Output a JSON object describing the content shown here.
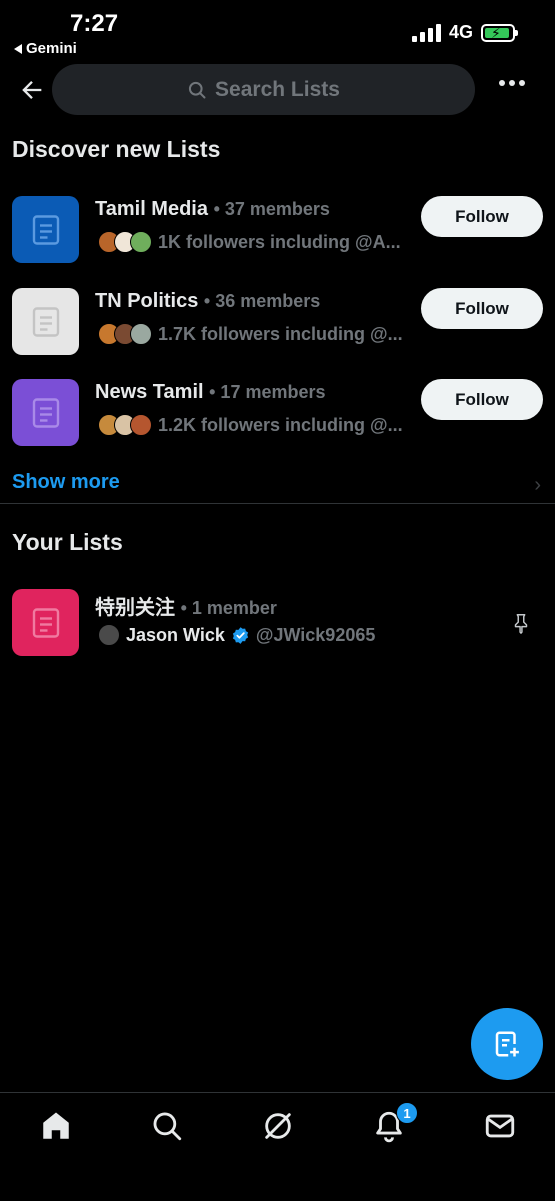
{
  "status_bar": {
    "time": "7:27",
    "back_app": "Gemini",
    "network": "4G"
  },
  "header": {
    "search_placeholder": "Search Lists"
  },
  "discover": {
    "title": "Discover new Lists",
    "items": [
      {
        "name": "Tamil Media",
        "members": "• 37 members",
        "followers": "1K followers including @A...",
        "follow_label": "Follow",
        "icon_color": "#0b5bb5",
        "icon_fg": "#5b9ae0"
      },
      {
        "name": "TN Politics",
        "members": "• 36 members",
        "followers": "1.7K followers including @...",
        "follow_label": "Follow",
        "icon_color": "#e6e6e6",
        "icon_fg": "#c4c4c4"
      },
      {
        "name": "News Tamil",
        "members": "• 17 members",
        "followers": "1.2K followers including @...",
        "follow_label": "Follow",
        "icon_color": "#7b4fd6",
        "icon_fg": "#a98ae8"
      }
    ],
    "show_more": "Show more"
  },
  "your_lists": {
    "title": "Your Lists",
    "items": [
      {
        "name": "特别关注",
        "members": "• 1 member",
        "owner_name": "Jason Wick",
        "owner_handle": "@JWick92065",
        "icon_color": "#e0245e",
        "icon_fg": "#f07aa0"
      }
    ]
  },
  "tabbar": {
    "tabs": [
      "home-icon",
      "search-icon",
      "grok-icon",
      "notifications-icon",
      "messages-icon"
    ],
    "notification_badge": "1"
  },
  "colors": {
    "accent": "#1d9bf0",
    "background": "#000000"
  }
}
